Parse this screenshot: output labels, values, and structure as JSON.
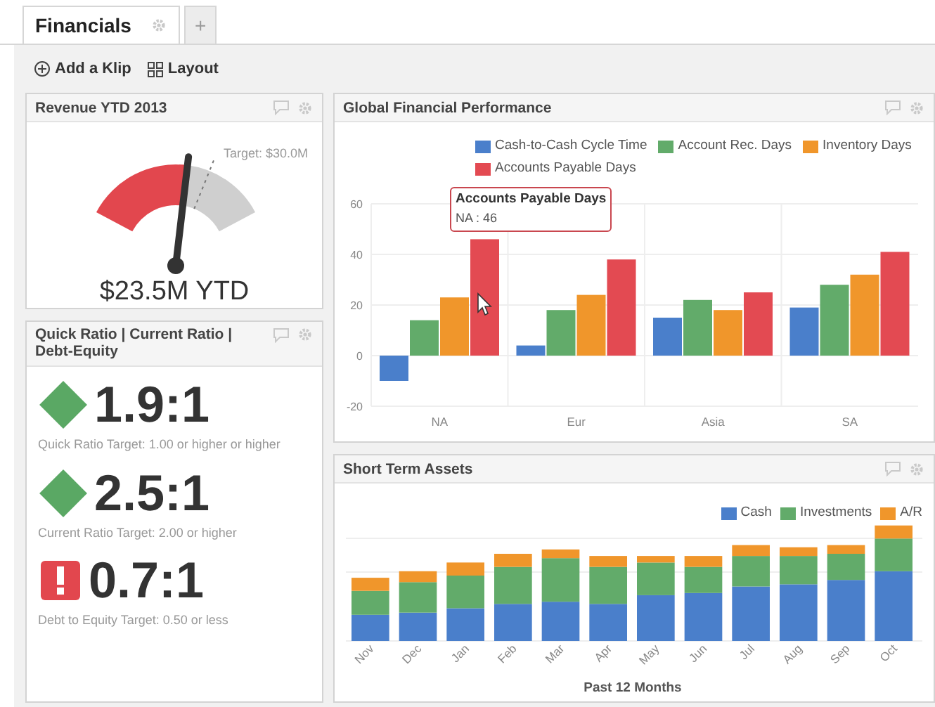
{
  "tabs": [
    {
      "label": "Financials",
      "selected": true
    },
    {
      "label": "+",
      "selected": false
    }
  ],
  "toolbar": [
    "Add a Klip",
    "Layout"
  ],
  "revenue": {
    "title": "Revenue YTD 2013",
    "target": "Target: $30.0M",
    "value": "$23.5M YTD"
  },
  "ratios": {
    "title": "Quick Ratio | Current Ratio | Debt-Equity",
    "items": [
      {
        "kind": "diamond",
        "color": "#5aa864",
        "value": "1.9:1",
        "caption": "Quick Ratio Target: 1.00 or higher or higher"
      },
      {
        "kind": "diamond",
        "color": "#5aa864",
        "value": "2.5:1",
        "caption": "Current Ratio Target: 2.00 or higher"
      },
      {
        "kind": "alert",
        "color": "#e2474e",
        "value": "0.7:1",
        "caption": "Debt to Equity Target: 0.50 or less"
      }
    ]
  },
  "performance": {
    "title": "Global Financial Performance",
    "chart_data": {
      "type": "bar",
      "categories": [
        "NA",
        "Eur",
        "Asia",
        "SA"
      ],
      "series": [
        {
          "name": "Cash-to-Cash Cycle Time",
          "color": "#4a7fcb",
          "values": [
            -10,
            4,
            15,
            19
          ]
        },
        {
          "name": "Account Rec. Days",
          "color": "#62ab6a",
          "values": [
            14,
            18,
            22,
            28
          ]
        },
        {
          "name": "Inventory Days",
          "color": "#f0962b",
          "values": [
            23,
            24,
            18,
            32
          ]
        },
        {
          "name": "Accounts Payable Days",
          "color": "#e34a52",
          "values": [
            46,
            38,
            25,
            41
          ]
        }
      ],
      "ylim": [
        -20,
        60
      ],
      "yticks": [
        -20,
        0,
        20,
        40,
        60
      ],
      "grid": true,
      "legend": true
    },
    "tooltip": {
      "title": "Accounts Payable Days",
      "text": "NA : 46"
    }
  },
  "assets": {
    "title": "Short Term Assets",
    "legend": [
      {
        "name": "Cash",
        "color": "#4a7fcb"
      },
      {
        "name": "Investments",
        "color": "#62ab6a"
      },
      {
        "name": "A/R",
        "color": "#f0962b"
      }
    ],
    "months": [
      "Nov",
      "Dec",
      "Jan",
      "Feb",
      "Mar",
      "Apr",
      "May",
      "Jun",
      "Jul",
      "Aug",
      "Sep",
      "Oct"
    ],
    "xlabel": "Past 12 Months"
  }
}
